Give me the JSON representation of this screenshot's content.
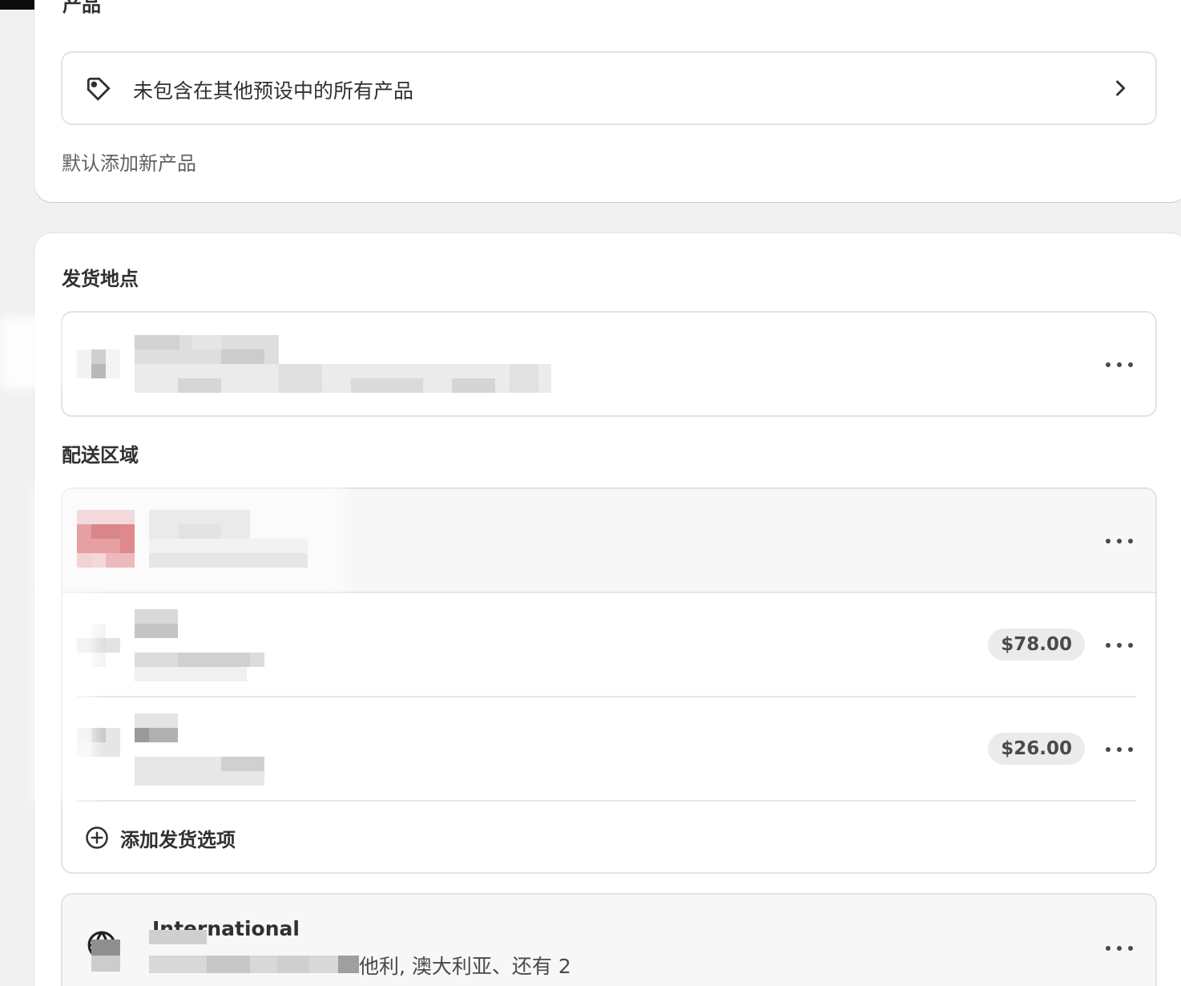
{
  "products_section": {
    "title_cut": "产品",
    "row_label": "未包含在其他预设中的所有产品",
    "note": "默认添加新产品"
  },
  "shipping_origin": {
    "title": "发货地点"
  },
  "shipping_zones": {
    "title": "配送区域",
    "rates": [
      {
        "price": "$78.00"
      },
      {
        "price": "$26.00"
      }
    ],
    "add_option_label": "添加发货选项"
  },
  "international": {
    "title": "International",
    "countries_partial": "他利, 澳大利亚、还有 2"
  },
  "icons": {
    "tag": "tag-icon",
    "chevron": "chevron-right-icon",
    "more": "more-horizontal-icon",
    "add": "plus-circle-icon",
    "globe": "globe-icon"
  }
}
